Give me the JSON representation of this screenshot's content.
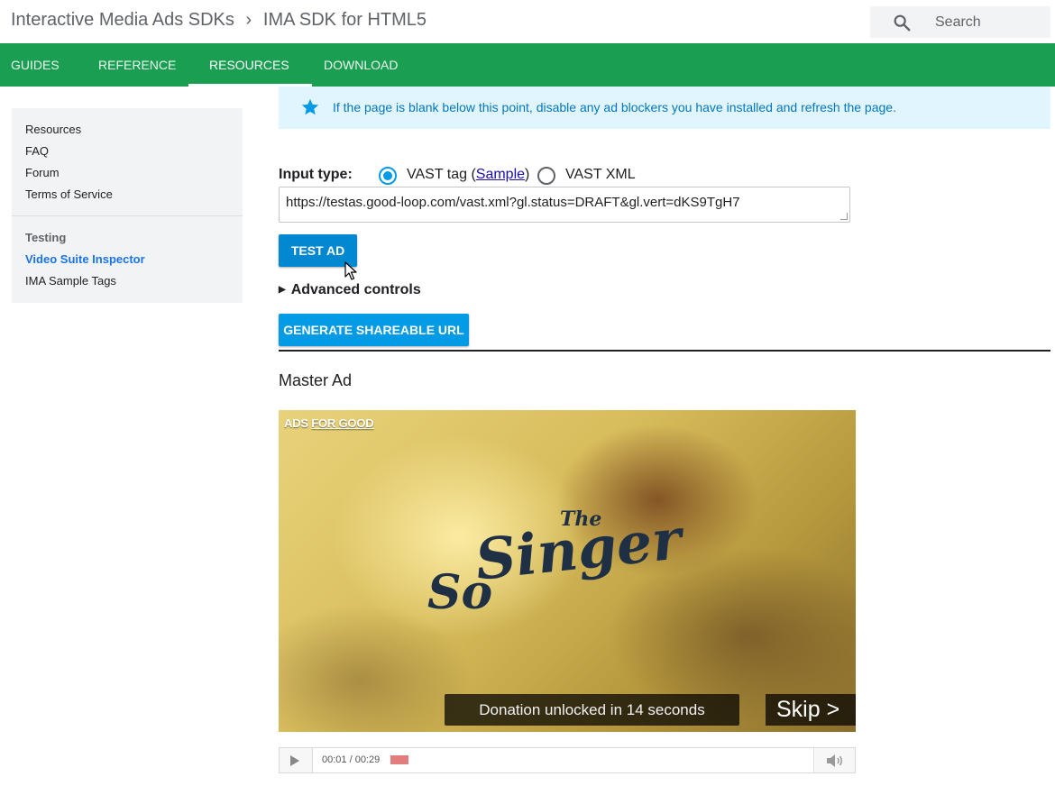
{
  "header": {
    "breadcrumb": [
      "Interactive Media Ads SDKs",
      "IMA SDK for HTML5"
    ],
    "search_placeholder": "Search"
  },
  "tabs": [
    {
      "label": "Guides",
      "active": false
    },
    {
      "label": "Reference",
      "active": false
    },
    {
      "label": "Resources",
      "active": true
    },
    {
      "label": "Download",
      "active": false
    }
  ],
  "sidebar": {
    "items": [
      "Resources",
      "FAQ",
      "Forum",
      "Terms of Service"
    ],
    "section_heading": "Testing",
    "section_items": [
      {
        "label": "Video Suite Inspector",
        "active": true
      },
      {
        "label": "IMA Sample Tags",
        "active": false
      }
    ]
  },
  "notice": {
    "text": "If the page is blank below this point, disable any ad blockers you have installed and refresh the page."
  },
  "form": {
    "input_type_label": "Input type:",
    "option_vast_tag": "VAST tag (",
    "option_vast_tag_link": "Sample",
    "option_vast_tag_close": ")",
    "option_vast_xml": "VAST XML",
    "selected": "VAST tag",
    "vast_url": "https://testas.good-loop.com/vast.xml?gl.status=DRAFT&gl.vert=dKS9TgH7",
    "test_button": "Test ad",
    "advanced_controls": "Advanced controls",
    "share_button": "Generate shareable URL"
  },
  "master_ad": {
    "title": "Master Ad",
    "video": {
      "logo_text_a": "ADS ",
      "logo_text_b": "FOR GOOD",
      "title_the": "The",
      "title_singer": "Singer",
      "title_so": "So",
      "donation_text": "Donation unlocked in 14 seconds",
      "skip_text": "Skip >"
    },
    "player": {
      "time": "00:01 / 00:29",
      "progress_fraction": 0.042
    }
  },
  "colors": {
    "brand_green": "#1a9f52",
    "link_blue": "#1a73e8",
    "button_blue": "#039be5",
    "notice_bg": "#e1f5fe"
  }
}
